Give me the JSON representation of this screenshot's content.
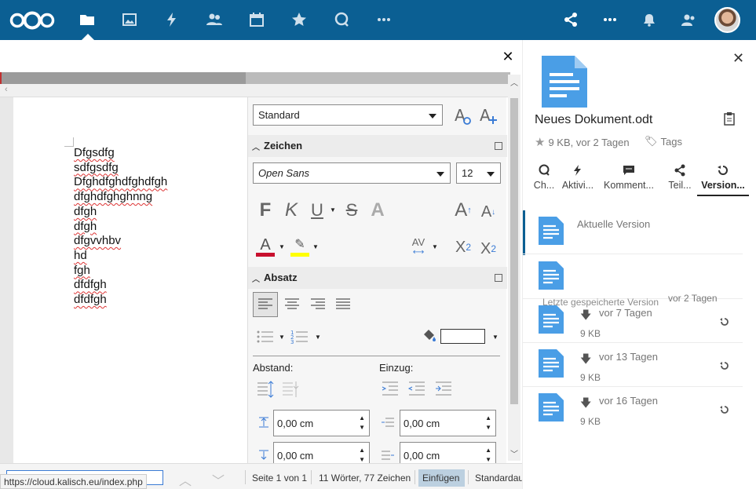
{
  "header": {
    "apps": [
      "files-icon",
      "photos-icon",
      "activity-icon",
      "contacts-icon",
      "calendar-icon",
      "favorites-icon",
      "talk-icon",
      "more-apps-icon"
    ],
    "right_icons": [
      "share-icon",
      "more-icon",
      "notifications-icon",
      "contacts-menu-icon"
    ]
  },
  "editor": {
    "close_symbol": "✕",
    "document_lines": [
      "Dfgsdfg",
      "sdfgsdfg",
      "Dfghdfghdfghdfgh",
      "dfghdfghghnng",
      "dfgh",
      "dfgh",
      "dfgvvhbv",
      "hd",
      "fgh",
      "dfdfgh",
      "dfdfgh"
    ]
  },
  "format_panel": {
    "paragraph_style": "Standard",
    "character_section": "Zeichen",
    "font_name": "Open Sans",
    "font_size": "12",
    "paragraph_section": "Absatz",
    "spacing_label": "Abstand:",
    "indent_label": "Einzug:",
    "spacing_above": "0,00 cm",
    "spacing_below": "0,00 cm",
    "indent_before": "0,00 cm",
    "indent_after": "0,00 cm"
  },
  "statusbar": {
    "page": "Seite 1 von 1",
    "words": "11 Wörter, 77 Zeichen",
    "mode": "Einfügen",
    "style": "Standardau",
    "url": "https://cloud.kalisch.eu/index.php"
  },
  "sidebar": {
    "file_name": "Neues Dokument.odt",
    "file_meta": "9 KB, vor 2 Tagen",
    "tags_label": "Tags",
    "tabs": [
      "Ch...",
      "Aktivi...",
      "Komment...",
      "Teil...",
      "Version..."
    ],
    "versions": [
      {
        "title": "Aktuelle Version",
        "size": ""
      },
      {
        "title": "Letzte gespeicherte Version",
        "time": "vor 2 Tagen"
      },
      {
        "time": "vor 7 Tagen",
        "size": "9 KB"
      },
      {
        "time": "vor 13 Tagen",
        "size": "9 KB"
      },
      {
        "time": "vor 16 Tagen",
        "size": "9 KB"
      }
    ]
  },
  "colors": {
    "brand": "#0b5f93",
    "doc_icon": "#4a9ee6",
    "font_color": "#c8102e",
    "highlight": "#ffff00"
  }
}
